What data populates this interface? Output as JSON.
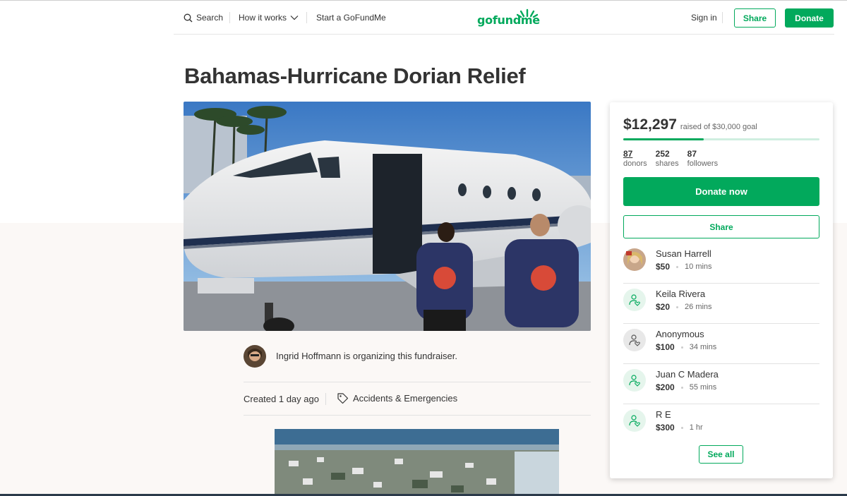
{
  "header": {
    "search_label": "Search",
    "how_it_works_label": "How it works",
    "start_label": "Start a GoFundMe",
    "logo_text": "gofundme",
    "sign_in_label": "Sign in",
    "share_label": "Share",
    "donate_label": "Donate"
  },
  "campaign": {
    "title": "Bahamas-Hurricane Dorian Relief",
    "organizer_text": "Ingrid Hoffmann is organizing this fundraiser.",
    "created": "Created 1 day ago",
    "category": "Accidents & Emergencies"
  },
  "card": {
    "raised": "$12,297",
    "goal_text": "raised of $30,000 goal",
    "progress": 0.41,
    "stats": [
      {
        "num": "87",
        "label": "donors"
      },
      {
        "num": "252",
        "label": "shares"
      },
      {
        "num": "87",
        "label": "followers"
      }
    ],
    "donate_now_label": "Donate now",
    "share_label": "Share",
    "see_all_label": "See all"
  },
  "donors": [
    {
      "name": "Susan Harrell",
      "amount": "$50",
      "time": "10 mins",
      "avatar": "photo"
    },
    {
      "name": "Keila Rivera",
      "amount": "$20",
      "time": "26 mins",
      "avatar": "green"
    },
    {
      "name": "Anonymous",
      "amount": "$100",
      "time": "34 mins",
      "avatar": "gray"
    },
    {
      "name": "Juan C Madera",
      "amount": "$200",
      "time": "55 mins",
      "avatar": "green"
    },
    {
      "name": "R E",
      "amount": "$300",
      "time": "1 hr",
      "avatar": "green"
    }
  ],
  "colors": {
    "brand_green": "#02a95c",
    "text": "#333333",
    "muted": "#666666"
  },
  "icons": [
    "search-icon",
    "chevron-down-icon",
    "tag-icon",
    "donor-heart-icon",
    "logo-sprout-icon"
  ]
}
